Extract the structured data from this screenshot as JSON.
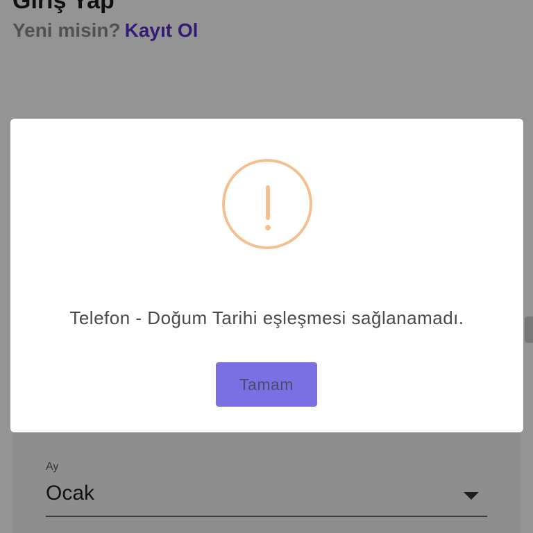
{
  "page": {
    "title": "Giriş Yap",
    "signup_question": "Yeni misin?",
    "signup_link": "Kayıt Ol"
  },
  "form": {
    "month_label": "Ay",
    "month_value": "Ocak"
  },
  "dialog": {
    "icon": "warning-exclamation-icon",
    "message": "Telefon - Doğum Tarihi eşleşmesi sağlanamadı.",
    "confirm_label": "Tamam"
  },
  "colors": {
    "accent": "#5a30c8",
    "button": "#7a6fe3",
    "warning": "#f5c08f"
  }
}
